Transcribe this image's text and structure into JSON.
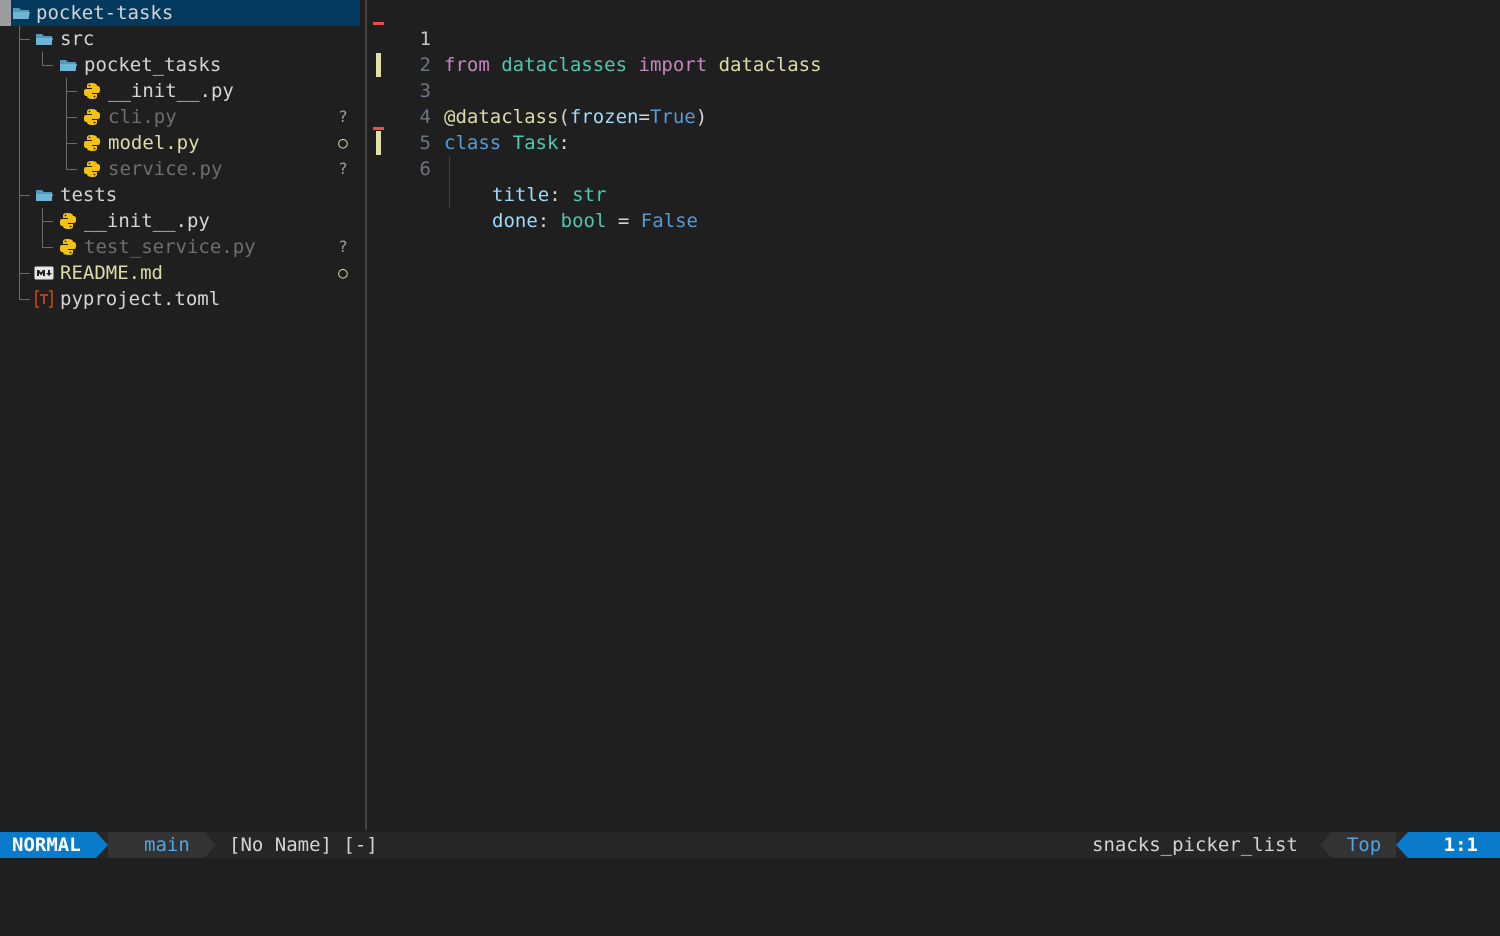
{
  "explorer": {
    "root": {
      "label": "pocket-tasks"
    },
    "items": [
      {
        "label": "src"
      },
      {
        "label": "pocket_tasks"
      },
      {
        "label": "__init__.py"
      },
      {
        "label": "cli.py",
        "status": "?"
      },
      {
        "label": "model.py",
        "status": "○"
      },
      {
        "label": "service.py",
        "status": "?"
      },
      {
        "label": "tests"
      },
      {
        "label": "__init__.py"
      },
      {
        "label": "test_service.py",
        "status": "?"
      },
      {
        "label": "README.md",
        "status": "○"
      },
      {
        "label": "pyproject.toml"
      }
    ]
  },
  "editor": {
    "line_numbers": [
      "1",
      "2",
      "3",
      "4",
      "5",
      "6"
    ],
    "lines": {
      "l1": {
        "from": "from",
        "mod": "dataclasses",
        "import": "import",
        "name": "dataclass"
      },
      "l3": {
        "dec": "@dataclass",
        "open": "(",
        "param": "frozen",
        "eq": "=",
        "val": "True",
        "close": ")"
      },
      "l4": {
        "kw": "class",
        "cls": "Task",
        "colon": ":"
      },
      "l5": {
        "field": "title",
        "colon": ":",
        "type": "str"
      },
      "l6": {
        "field": "done",
        "colon": ":",
        "type": "bool",
        "eq": "=",
        "val": "False"
      }
    }
  },
  "statusline": {
    "mode": "NORMAL",
    "branch": "main",
    "file": "[No Name] [-]",
    "filetype": "snacks_picker_list",
    "position": "Top",
    "cursor": "1:1"
  },
  "colors": {
    "accent": "#0a7aca",
    "background": "#1f1f1f",
    "selection": "#04395e",
    "git_add": "#e2e0a8",
    "git_delete": "#f14c4c",
    "python_icon": "#f5c20f",
    "folder_icon": "#519aba",
    "toml_icon": "#c2451b"
  }
}
